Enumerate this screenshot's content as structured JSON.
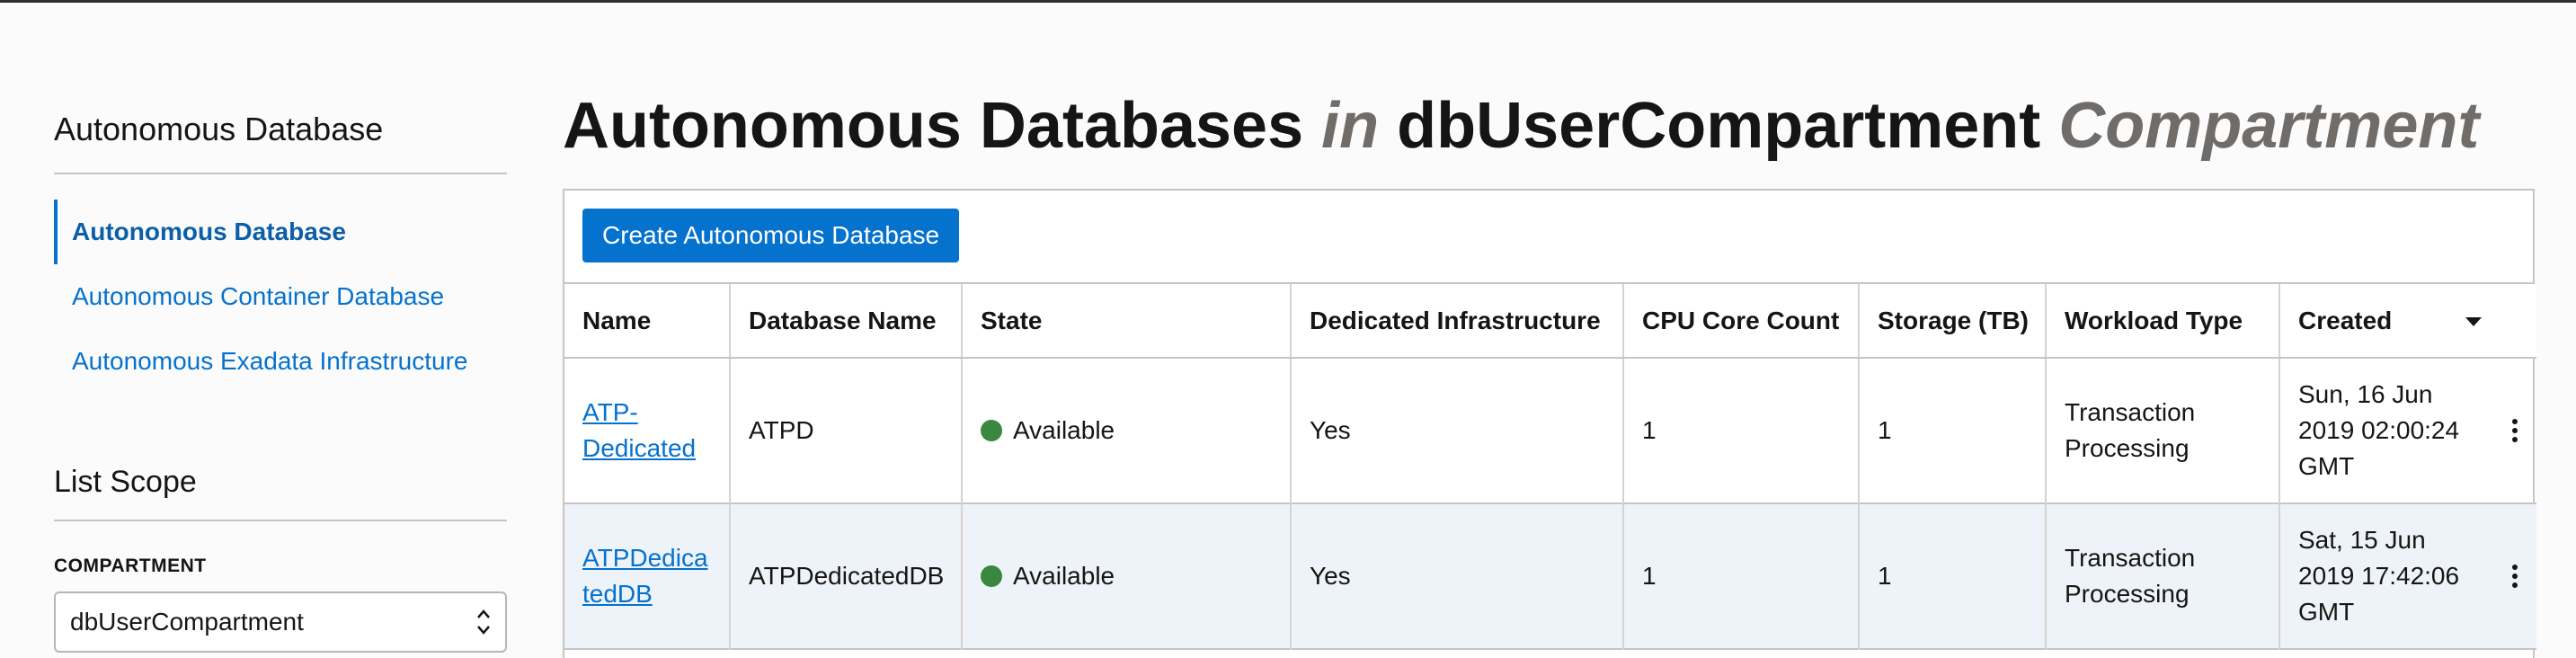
{
  "sidebar": {
    "title": "Autonomous Database",
    "nav": [
      {
        "label": "Autonomous Database",
        "active": true
      },
      {
        "label": "Autonomous Container Database",
        "active": false
      },
      {
        "label": "Autonomous Exadata Infrastructure",
        "active": false
      }
    ],
    "scope_title": "List Scope",
    "compartment_label": "COMPARTMENT",
    "compartment_value": "dbUserCompartment",
    "compartment_hint": "..."
  },
  "page": {
    "title_main": "Autonomous Databases",
    "title_in": "in",
    "title_compartment": "dbUserCompartment",
    "title_suffix": "Compartment"
  },
  "toolbar": {
    "create_label": "Create Autonomous Database"
  },
  "table": {
    "columns": [
      "Name",
      "Database Name",
      "State",
      "Dedicated Infrastructure",
      "CPU Core Count",
      "Storage (TB)",
      "Workload Type",
      "Created"
    ],
    "rows": [
      {
        "name_line1": "ATP-",
        "name_line2": "Dedicated",
        "db_name": "ATPD",
        "state": "Available",
        "dedicated": "Yes",
        "cpu": "1",
        "storage": "1",
        "workload_line1": "Transaction",
        "workload_line2": "Processing",
        "created_line1": "Sun, 16 Jun",
        "created_line2": "2019 02:00:24",
        "created_line3": "GMT"
      },
      {
        "name_line1": "ATPDedica",
        "name_line2": "tedDB",
        "db_name": "ATPDedicatedDB",
        "state": "Available",
        "dedicated": "Yes",
        "cpu": "1",
        "storage": "1",
        "workload_line1": "Transaction",
        "workload_line2": "Processing",
        "created_line1": "Sat, 15 Jun",
        "created_line2": "2019 17:42:06",
        "created_line3": "GMT"
      }
    ]
  },
  "colors": {
    "accent": "#0572ce",
    "available": "#3b873f",
    "row_alt": "#eef3fa"
  }
}
